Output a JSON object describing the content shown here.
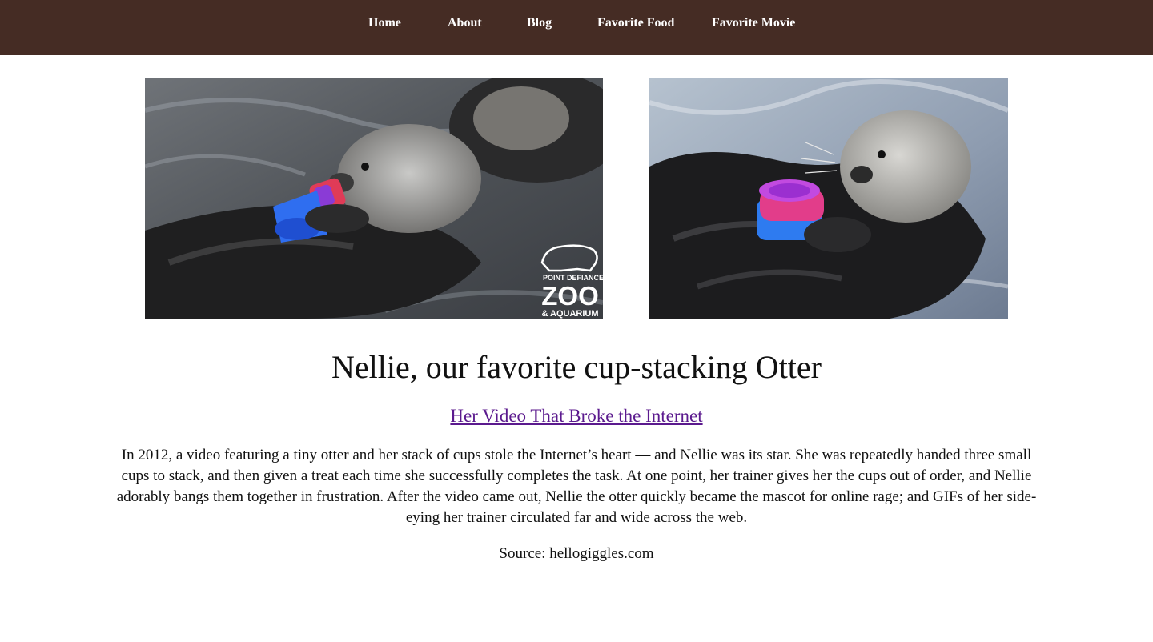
{
  "nav": {
    "items": [
      {
        "label": "Home"
      },
      {
        "label": "About"
      },
      {
        "label": "Blog"
      },
      {
        "label": "Favorite Food"
      },
      {
        "label": "Favorite Movie"
      }
    ],
    "background": "#452c24"
  },
  "photos": {
    "left": {
      "watermark_line1": "POINT DEFIANCE",
      "watermark_line2": "ZOO",
      "watermark_line3": "& AQUARIUM"
    },
    "right": {}
  },
  "main": {
    "title": "Nellie, our favorite cup-stacking Otter",
    "video_link": "Her Video That Broke the Internet",
    "paragraph": "In 2012, a video featuring a tiny otter and her stack of cups stole the Internet’s heart — and Nellie was its star. She was repeatedly handed three small cups to stack, and then given a treat each time she successfully completes the task. At one point, her trainer gives her the cups out of order, and Nellie adorably bangs them together in frustration. After the video came out, Nellie the otter quickly became the mascot for online rage; and GIFs of her side-eying her trainer circulated far and wide across the web.",
    "source": "Source: hellogiggles.com"
  },
  "colors": {
    "nav_bg": "#452c24",
    "link": "#5b1a8e",
    "text": "#111111"
  }
}
